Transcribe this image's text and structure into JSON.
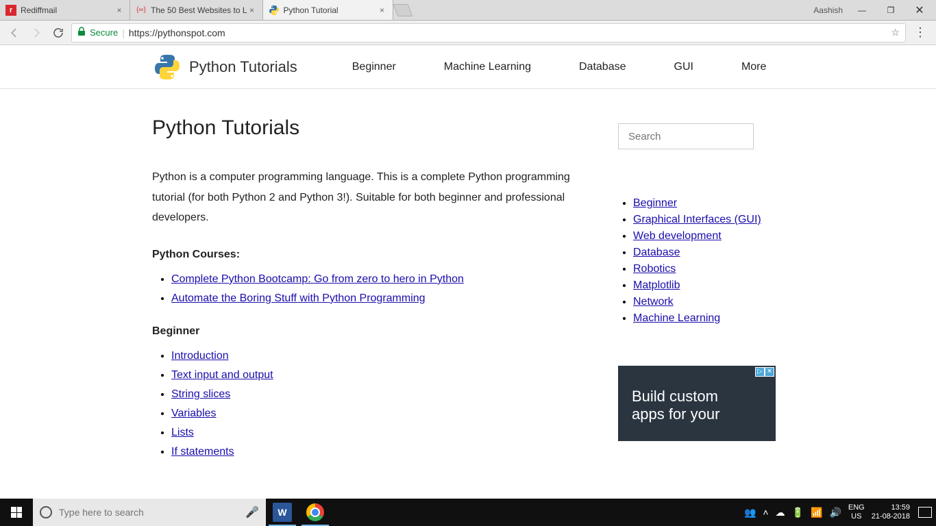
{
  "window": {
    "tabs": [
      {
        "title": "Rediffmail",
        "favicon": "R"
      },
      {
        "title": "The 50 Best Websites to L",
        "favicon": "{∞}"
      },
      {
        "title": "Python Tutorial",
        "favicon": "py"
      }
    ],
    "user": "Aashish"
  },
  "addressbar": {
    "secure_label": "Secure",
    "url": "https://pythonspot.com"
  },
  "site": {
    "brand": "Python Tutorials",
    "nav": [
      "Beginner",
      "Machine Learning",
      "Database",
      "GUI",
      "More"
    ]
  },
  "page": {
    "title": "Python Tutorials",
    "intro": "Python is a computer programming language. This is a complete Python programming tutorial (for both Python 2 and Python 3!). Suitable for both beginner and professional developers.",
    "courses_heading": "Python Courses:",
    "courses": [
      "Complete Python Bootcamp: Go from zero to hero in Python",
      "Automate the Boring Stuff with Python Programming"
    ],
    "beginner_heading": "Beginner",
    "beginner_links": [
      "Introduction",
      "Text input and output",
      "String slices",
      "Variables",
      "Lists",
      "If statements"
    ]
  },
  "sidebar": {
    "search_placeholder": "Search",
    "links": [
      "Beginner",
      "Graphical Interfaces (GUI)",
      "Web development",
      "Database",
      "Robotics",
      "Matplotlib",
      "Network",
      "Machine Learning"
    ],
    "ad_line1": "Build custom",
    "ad_line2": "apps for your"
  },
  "taskbar": {
    "search_placeholder": "Type here to search",
    "lang1": "ENG",
    "lang2": "US",
    "time": "13:59",
    "date": "21-08-2018"
  }
}
